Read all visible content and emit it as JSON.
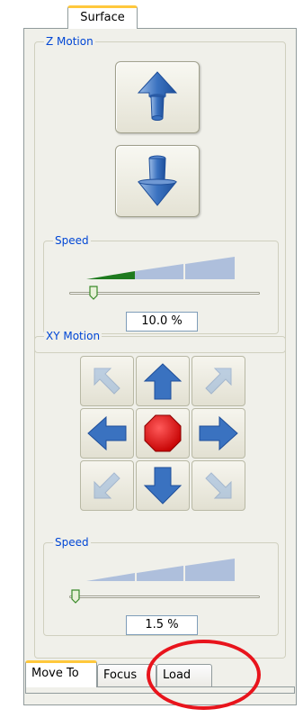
{
  "top_tab": {
    "label": "Surface"
  },
  "z_motion": {
    "title": "Z Motion",
    "speed": {
      "title": "Speed",
      "value_text": "10.0 %",
      "level": 0.1
    }
  },
  "xy_motion": {
    "title": "XY Motion",
    "speed": {
      "title": "Speed",
      "value_text": "1.5 %",
      "level": 0.015
    }
  },
  "bottom_tabs": [
    {
      "label": "Move To",
      "active": true
    },
    {
      "label": "Focus",
      "active": false
    },
    {
      "label": "Load",
      "active": false
    }
  ],
  "colors": {
    "panel_bg": "#f0f0ea",
    "group_title": "#0046d5",
    "arrow_blue": "#3a72c0",
    "stop_red": "#e00000",
    "ramp_fill": "#aebfdc",
    "ramp_active": "#1e7a1e",
    "tab_highlight": "#ffc83c",
    "annotation_red": "#e8141c"
  },
  "icons": [
    "arrow-up-icon",
    "arrow-down-icon",
    "arrow-upleft-icon",
    "arrow-upright-icon",
    "arrow-left-icon",
    "stop-icon",
    "arrow-right-icon",
    "arrow-downleft-icon",
    "arrow-downright-icon"
  ]
}
